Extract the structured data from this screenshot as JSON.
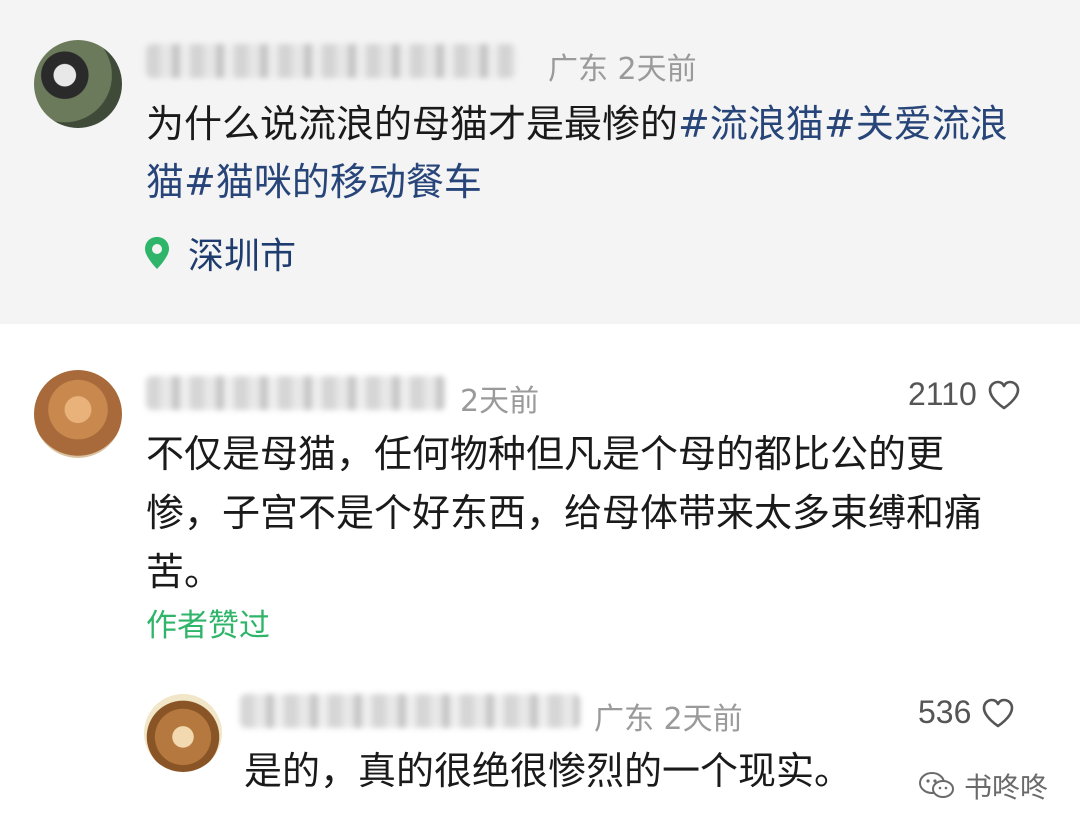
{
  "post": {
    "region": "广东",
    "time": "2天前",
    "text_plain": "为什么说流浪的母猫才是最惨的",
    "tags": [
      "#流浪猫",
      "#关爱流浪猫",
      "#猫咪的移动餐车"
    ],
    "location": "深圳市",
    "location_icon": "map-pin-icon"
  },
  "comments": [
    {
      "time": "2天前",
      "likes": "2110",
      "text": "不仅是母猫，任何物种但凡是个母的都比公的更惨，子宫不是个好东西，给母体带来太多束缚和痛苦。",
      "author_liked_label": "作者赞过"
    }
  ],
  "replies": [
    {
      "region": "广东",
      "time": "2天前",
      "likes": "536",
      "text": "是的，真的很绝很惨烈的一个现实。"
    }
  ],
  "watermark": {
    "text": "书咚咚",
    "icon": "wechat-icon"
  },
  "colors": {
    "accent_green": "#2fb56a",
    "tag_blue": "#28457a",
    "post_bg": "#f4f4f4"
  }
}
